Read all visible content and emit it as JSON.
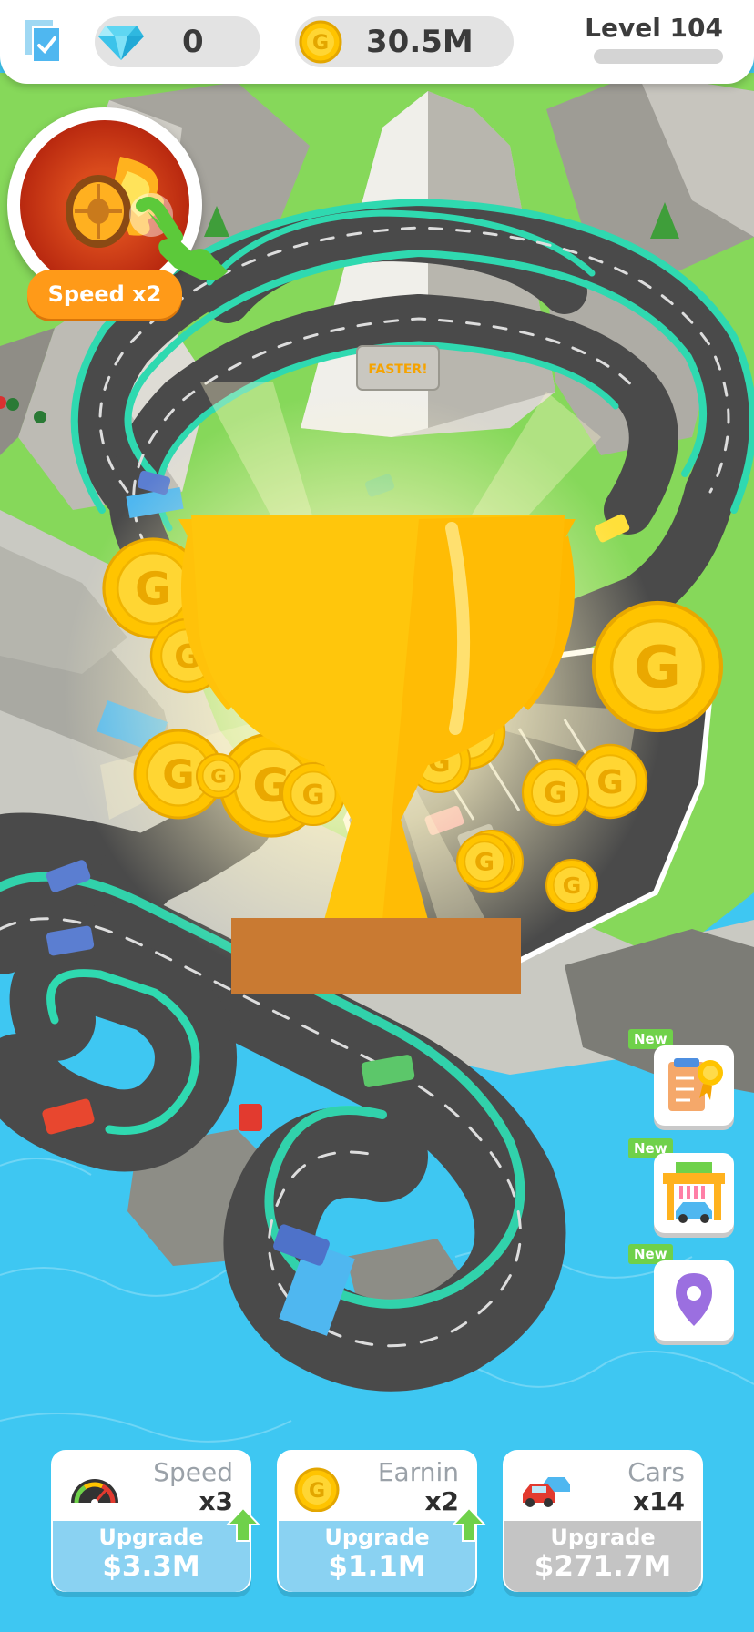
{
  "hud": {
    "checklist_icon": "checklist-icon",
    "gems_value": "0",
    "coins_value": "30.5M",
    "level_label": "Level 104",
    "level_progress": 0.0
  },
  "powerup": {
    "icon": "flaming-tire-icon",
    "label": "Speed x2"
  },
  "sign_text": "FASTER!",
  "side_buttons": [
    {
      "new_label": "New",
      "icon": "certificate-checklist-icon"
    },
    {
      "new_label": "New",
      "icon": "car-wash-icon"
    },
    {
      "new_label": "New",
      "icon": "location-pin-icon"
    }
  ],
  "trophy": {
    "icon": "trophy-icon",
    "coin_letter": "G"
  },
  "upgrades": [
    {
      "name": "Speed",
      "multiplier": "x3",
      "action": "Upgrade",
      "price": "$3.3M",
      "icon": "speedometer-icon",
      "state": "available"
    },
    {
      "name": "Earnin",
      "multiplier": "x2",
      "action": "Upgrade",
      "price": "$1.1M",
      "icon": "coin-icon",
      "state": "available"
    },
    {
      "name": "Cars",
      "multiplier": "x14",
      "action": "Upgrade",
      "price": "$271.7M",
      "icon": "cars-icon",
      "state": "locked"
    }
  ],
  "colors": {
    "water": "#3ec7f2",
    "grass": "#86d85a",
    "track": "#4a4a4a",
    "track_edge": "#2fd9b0",
    "gold": "#ffc400",
    "upgrade_available": "#8ad2f2",
    "upgrade_locked": "#c4c4c4",
    "powerup_label": "#ff9a18"
  }
}
